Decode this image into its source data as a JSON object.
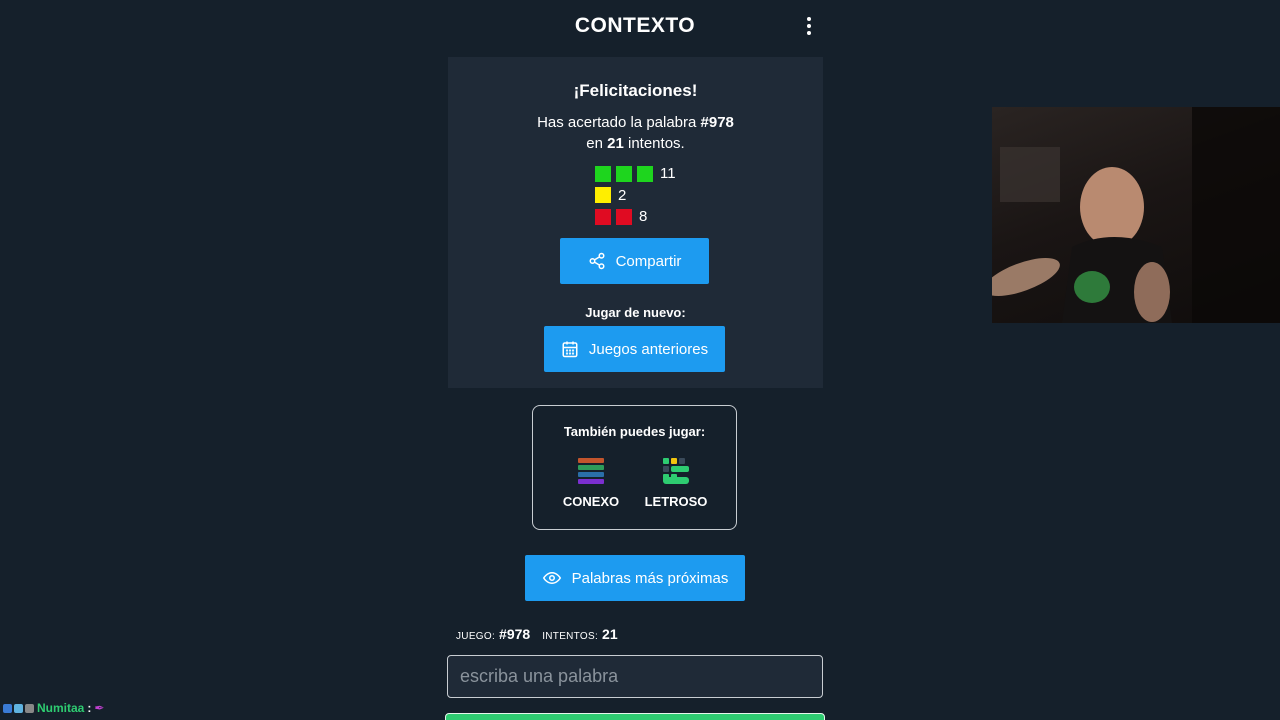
{
  "app": {
    "title": "CONTEXTO"
  },
  "result": {
    "congrats": "¡Felicitaciones!",
    "guessed_prefix": "Has acertado la palabra ",
    "game_number": "#978",
    "attempts_prefix": "en ",
    "attempts": "21",
    "attempts_suffix": " intentos.",
    "stats": [
      {
        "color": "green",
        "squares": 3,
        "count": "11"
      },
      {
        "color": "yellow",
        "squares": 1,
        "count": "2"
      },
      {
        "color": "red",
        "squares": 2,
        "count": "8"
      }
    ],
    "share_label": "Compartir",
    "play_again_label": "Jugar de nuevo:",
    "previous_games_label": "Juegos anteriores"
  },
  "also_play": {
    "title": "También puedes jugar:",
    "games": [
      {
        "name": "CONEXO",
        "icon": "conexo-icon"
      },
      {
        "name": "LETROSO",
        "icon": "letroso-icon"
      }
    ]
  },
  "closest_words_label": "Palabras más próximas",
  "game_info": {
    "game_label": "JUEGO:",
    "game_value": "#978",
    "attempts_label": "INTENTOS:",
    "attempts_value": "21"
  },
  "input": {
    "placeholder": "escriba una palabra",
    "value": ""
  },
  "chat": {
    "user": "Numitaa",
    "separator": ":"
  },
  "colors": {
    "background": "#15202b",
    "card": "#1f2a37",
    "accent_blue": "#1d9bf0",
    "green": "#1ed51e",
    "yellow": "#ffee00",
    "red": "#e00b22"
  }
}
